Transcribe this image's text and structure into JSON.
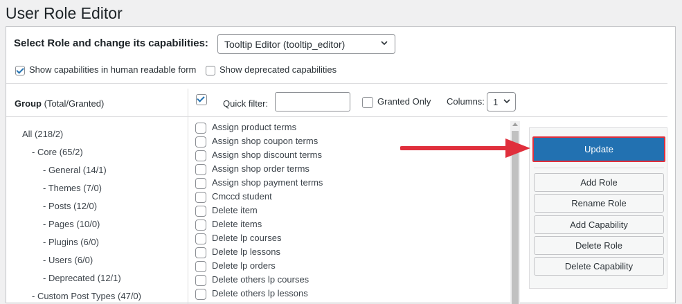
{
  "page": {
    "title": "User Role Editor"
  },
  "role": {
    "label": "Select Role and change its capabilities:",
    "selected": "Tooltip Editor (tooltip_editor)"
  },
  "options": {
    "human_readable": {
      "label": "Show capabilities in human readable form",
      "checked": true
    },
    "deprecated": {
      "label": "Show deprecated capabilities",
      "checked": false
    }
  },
  "groups": {
    "header_bold": "Group",
    "header_rest": " (Total/Granted)",
    "items": [
      {
        "label": "All (218/2)"
      },
      {
        "label": "- Core (65/2)"
      },
      {
        "label": "- General (14/1)"
      },
      {
        "label": "- Themes (7/0)"
      },
      {
        "label": "- Posts (12/0)"
      },
      {
        "label": "- Pages (10/0)"
      },
      {
        "label": "- Plugins (6/0)"
      },
      {
        "label": "- Users (6/0)"
      },
      {
        "label": "- Deprecated (12/1)"
      },
      {
        "label": "- Custom Post Types (47/0)"
      }
    ]
  },
  "filter": {
    "select_all_checked": true,
    "quick_filter_label": "Quick filter:",
    "quick_filter_value": "",
    "granted_only_label": "Granted Only",
    "granted_only_checked": false,
    "columns_label": "Columns:",
    "columns_value": "1"
  },
  "capabilities": [
    "Assign product terms",
    "Assign shop coupon terms",
    "Assign shop discount terms",
    "Assign shop order terms",
    "Assign shop payment terms",
    "Cmccd student",
    "Delete item",
    "Delete items",
    "Delete lp courses",
    "Delete lp lessons",
    "Delete lp orders",
    "Delete others lp courses",
    "Delete others lp lessons"
  ],
  "actions": {
    "update": "Update",
    "add_role": "Add Role",
    "rename_role": "Rename Role",
    "add_capability": "Add Capability",
    "delete_role": "Delete Role",
    "delete_capability": "Delete Capability"
  },
  "colors": {
    "primary": "#2271b1",
    "highlight": "#e02f3c"
  }
}
